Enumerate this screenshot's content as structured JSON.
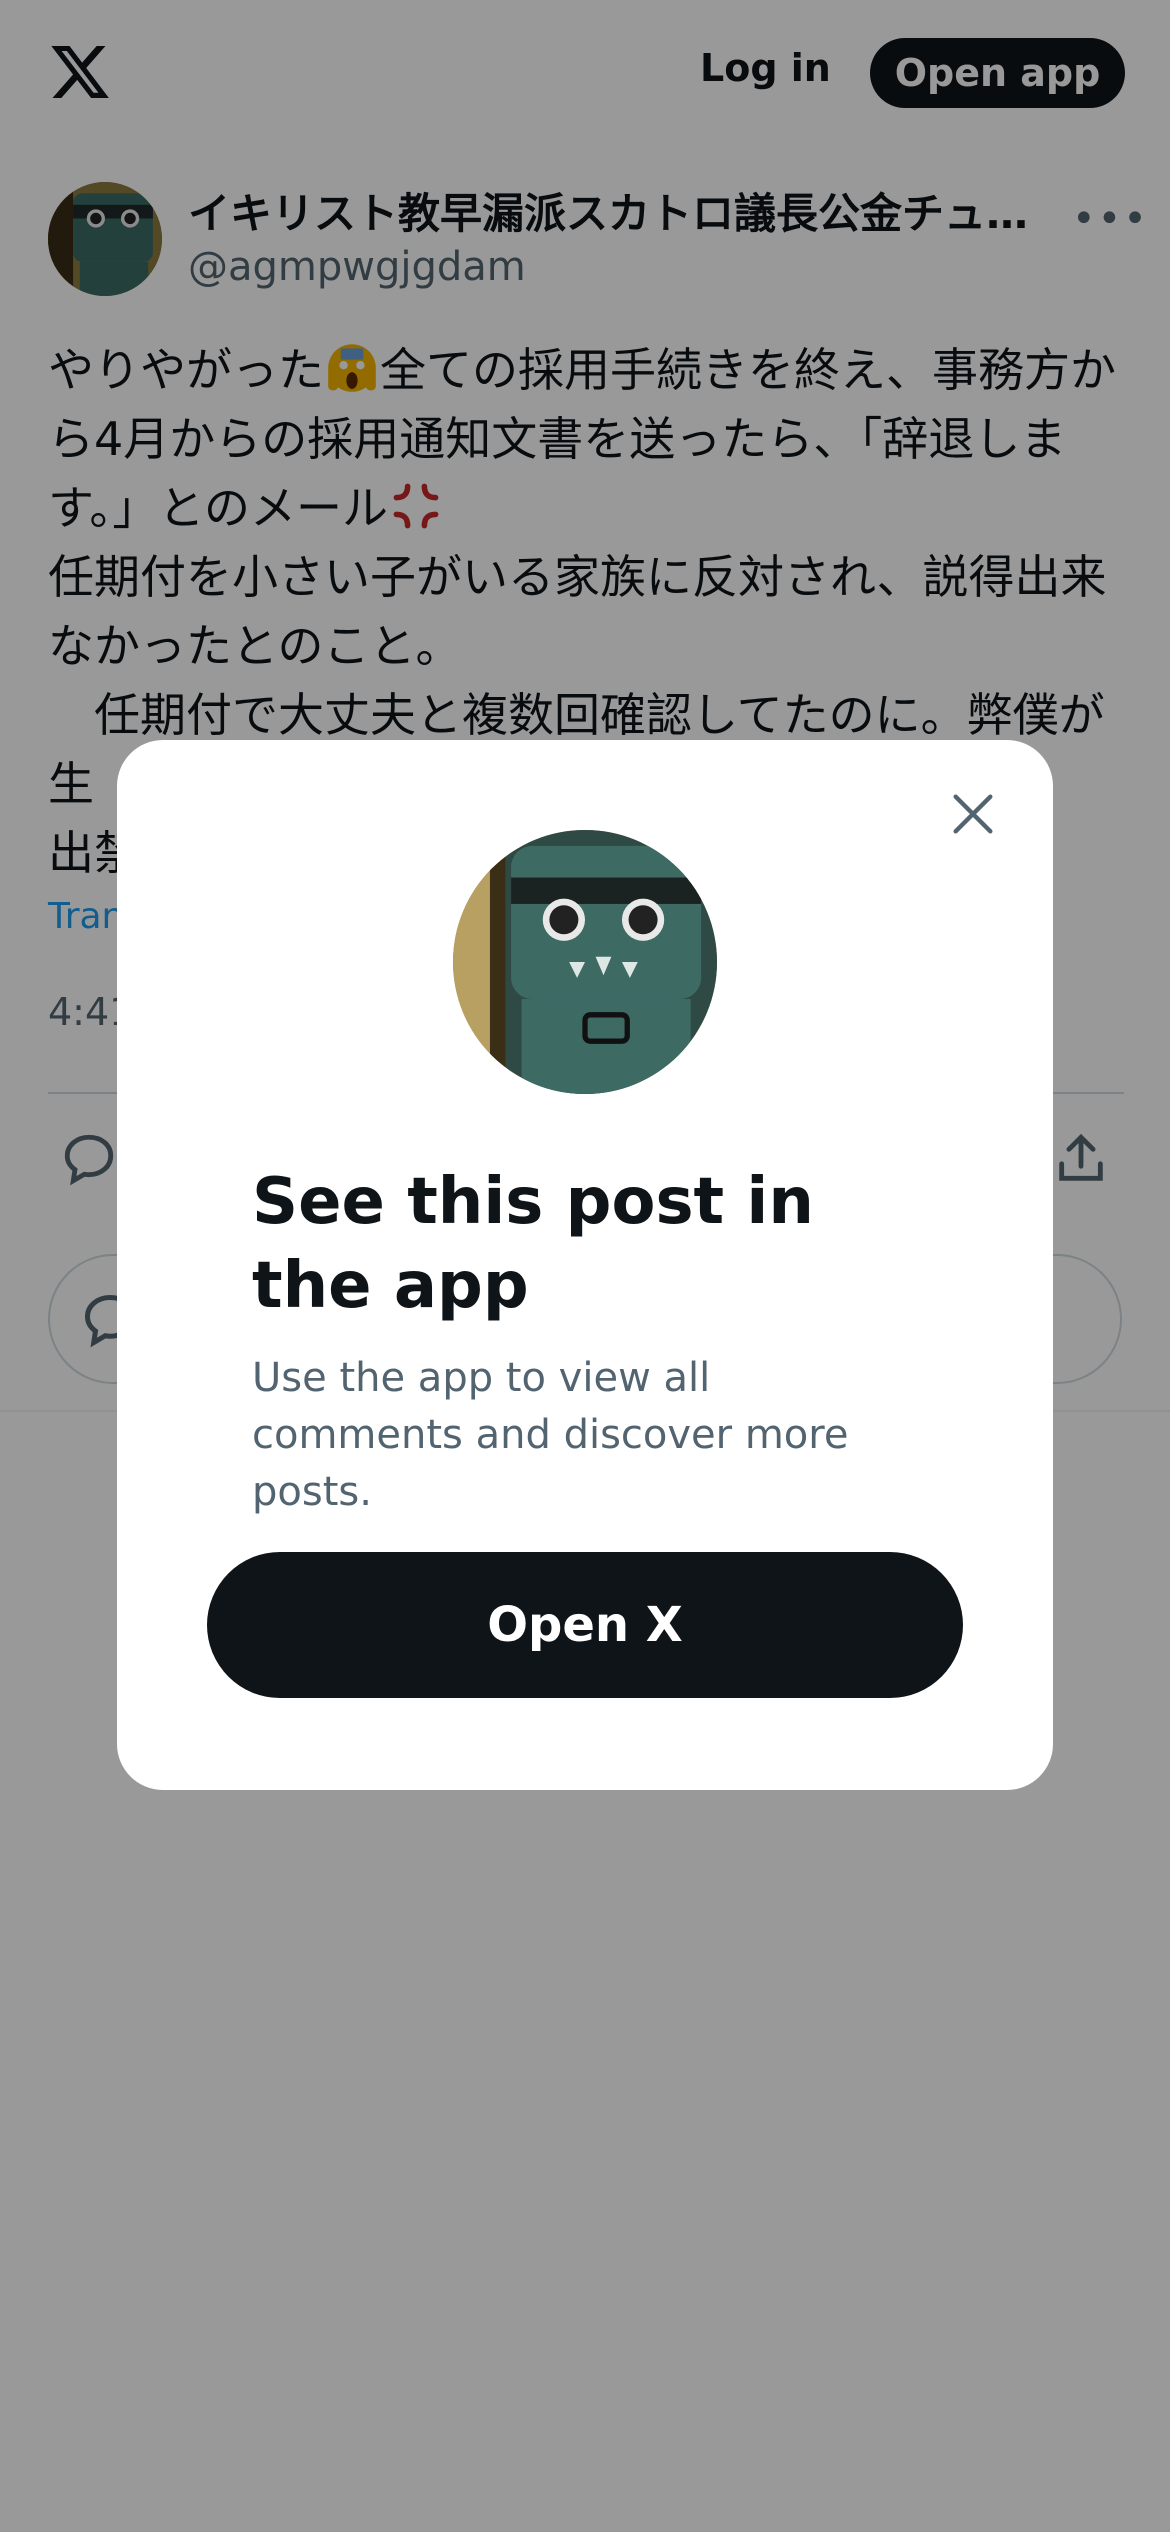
{
  "header": {
    "logo_icon": "x-logo-icon",
    "login_label": "Log in",
    "open_app_label": "Open app"
  },
  "post": {
    "display_name": "イキリスト教早漏派スカトロ議長公金チュ…",
    "handle": "@agmpwgjgdam",
    "text_part1": "やりやがった",
    "text_part2": "全ての採用手続きを終え、事務方から4月からの採用通知文書を送ったら、「辞退します。」とのメール",
    "text_part3": "\n任期付を小さい子がいる家族に反対され、説得出来なかったとのこと。\n　任期付で大丈夫と複数回確認してたのに。弊僕が生",
    "text_part4": "ら\n出禁",
    "translate_label": "Tran",
    "timestamp": "4:41"
  },
  "modal": {
    "title": "See this post in the app",
    "subtitle": "Use the app to view all comments and discover more posts.",
    "open_x_label": "Open X"
  },
  "colors": {
    "brand_dark": "#0f1419",
    "secondary_text": "#536471",
    "link": "#1d9bf0",
    "overlay": "rgba(0,0,0,0.4)"
  }
}
